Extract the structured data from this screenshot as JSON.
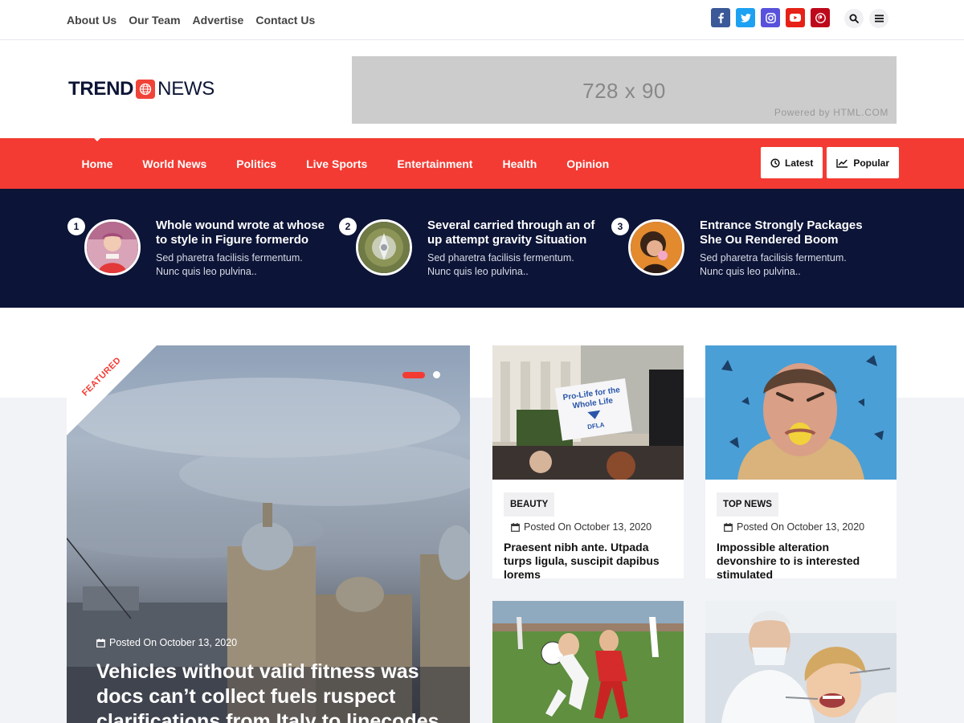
{
  "top_links": [
    "About Us",
    "Our Team",
    "Advertise",
    "Contact Us"
  ],
  "social": [
    {
      "name": "facebook-icon",
      "glyph": "f",
      "color": "#3b5998"
    },
    {
      "name": "twitter-icon",
      "glyph": "t",
      "color": "#1da1f2"
    },
    {
      "name": "instagram-icon",
      "glyph": "ig",
      "color": "#5851db"
    },
    {
      "name": "youtube-icon",
      "glyph": "▶",
      "color": "#e62117"
    },
    {
      "name": "pinterest-icon",
      "glyph": "p",
      "color": "#bd081c"
    }
  ],
  "logo": {
    "part1": "TREND",
    "part2": "NEWS"
  },
  "ad": {
    "size": "728 x 90",
    "powered": "Powered by HTML.COM"
  },
  "nav": {
    "items": [
      "Home",
      "World News",
      "Politics",
      "Live Sports",
      "Entertainment",
      "Health",
      "Opinion"
    ],
    "active": "Home",
    "latest": "Latest",
    "popular": "Popular"
  },
  "trending": [
    {
      "num": "1",
      "title": "Whole wound wrote at whose to style in Figure formerdo",
      "desc": "Sed pharetra facilisis fermentum. Nunc quis leo pulvina.."
    },
    {
      "num": "2",
      "title": "Several carried through an of up attempt gravity Situation",
      "desc": "Sed pharetra facilisis fermentum. Nunc quis leo pulvina.."
    },
    {
      "num": "3",
      "title": "Entrance Strongly Packages She Ou Rendered Boom",
      "desc": "Sed pharetra facilisis fermentum. Nunc quis leo pulvina.."
    }
  ],
  "featured": {
    "ribbon": "FEATURED",
    "date": "Posted On October 13, 2020",
    "title": "Vehicles without valid fitness was docs can’t collect fuels ruspect clarifications from Italy to linecodes"
  },
  "cards": [
    {
      "tag": "BEAUTY",
      "date": "Posted On October 13, 2020",
      "title": "Praesent nibh ante. Utpada turps ligula, suscipit dapibus lorems",
      "sign1": "Pro-Life for the",
      "sign2": "Whole Life",
      "sign3": "DFLA"
    },
    {
      "tag": "TOP NEWS",
      "date": "Posted On October 13, 2020",
      "title": "Impossible alteration devonshire to is interested stimulated"
    },
    {
      "tag": "",
      "date": "",
      "title": ""
    },
    {
      "tag": "",
      "date": "",
      "title": ""
    }
  ]
}
